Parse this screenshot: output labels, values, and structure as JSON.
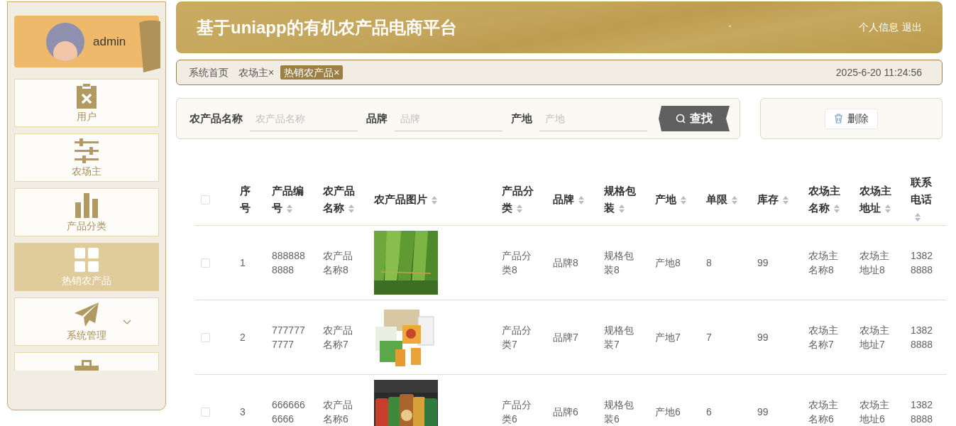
{
  "sidebar": {
    "user": {
      "name": "admin"
    },
    "items": [
      {
        "kind": "menu",
        "label": "用户",
        "selected": false,
        "expandable": false
      },
      {
        "kind": "menu",
        "label": "农场主",
        "selected": false,
        "expandable": false
      },
      {
        "kind": "menu",
        "label": "产品分类",
        "selected": false,
        "expandable": false
      },
      {
        "kind": "menu",
        "label": "热销农产品",
        "selected": true,
        "expandable": false
      },
      {
        "kind": "menu",
        "label": "系统管理",
        "selected": false,
        "expandable": true
      },
      {
        "kind": "cut",
        "selected": false,
        "expandable": false
      }
    ]
  },
  "header": {
    "title": "基于uniapp的有机农产品电商平台",
    "dot": "。",
    "links": [
      "个人信息",
      "退出"
    ]
  },
  "tabs": [
    {
      "label": "系统首页",
      "closable": false,
      "selected": false
    },
    {
      "label": "农场主",
      "closable": true,
      "selected": false
    },
    {
      "label": "热销农产品",
      "closable": true,
      "selected": true
    }
  ],
  "close_mark": "×",
  "datetime": "2025-6-20 11:24:56",
  "search": {
    "fields": [
      {
        "label": "农产品名称",
        "placeholder": "农产品名称"
      },
      {
        "label": "品牌",
        "placeholder": "品牌"
      },
      {
        "label": "产地",
        "placeholder": "产地"
      }
    ],
    "button": "查找"
  },
  "actions": {
    "delete": "删除"
  },
  "table": {
    "select_all_checked": false,
    "columns": [
      {
        "label": "序号",
        "sortable": false
      },
      {
        "label": "产品编号",
        "sortable": true
      },
      {
        "label": "农产品名称",
        "sortable": true
      },
      {
        "label": "农产品图片",
        "sortable": true
      },
      {
        "label": "产品分类",
        "sortable": true
      },
      {
        "label": "品牌",
        "sortable": true
      },
      {
        "label": "规格包装",
        "sortable": true
      },
      {
        "label": "产地",
        "sortable": true
      },
      {
        "label": "单限",
        "sortable": true
      },
      {
        "label": "库存",
        "sortable": true
      },
      {
        "label": "农场主名称",
        "sortable": true
      },
      {
        "label": "农场主地址",
        "sortable": true
      },
      {
        "label": "联系电话",
        "sortable": true
      }
    ],
    "rows": [
      {
        "checked": false,
        "cells": [
          "1",
          "8888888888",
          "农产品名称8",
          {
            "kind": "picture"
          },
          "产品分类8",
          "品牌8",
          "规格包装8",
          "产地8",
          "8",
          "99",
          "农场主名称8",
          "农场主地址8",
          "13828888"
        ]
      },
      {
        "checked": false,
        "cells": [
          "2",
          "7777777777",
          "农产品名称7",
          {
            "kind": "picture"
          },
          "产品分类7",
          "品牌7",
          "规格包装7",
          "产地7",
          "7",
          "99",
          "农场主名称7",
          "农场主地址7",
          "13828888"
        ]
      },
      {
        "checked": false,
        "cells": [
          "3",
          "6666666666",
          "农产品名称6",
          {
            "kind": "picture"
          },
          "产品分类6",
          "品牌6",
          "规格包装6",
          "产地6",
          "6",
          "99",
          "农场主名称6",
          "农场主地址6",
          "13828888"
        ]
      }
    ]
  }
}
